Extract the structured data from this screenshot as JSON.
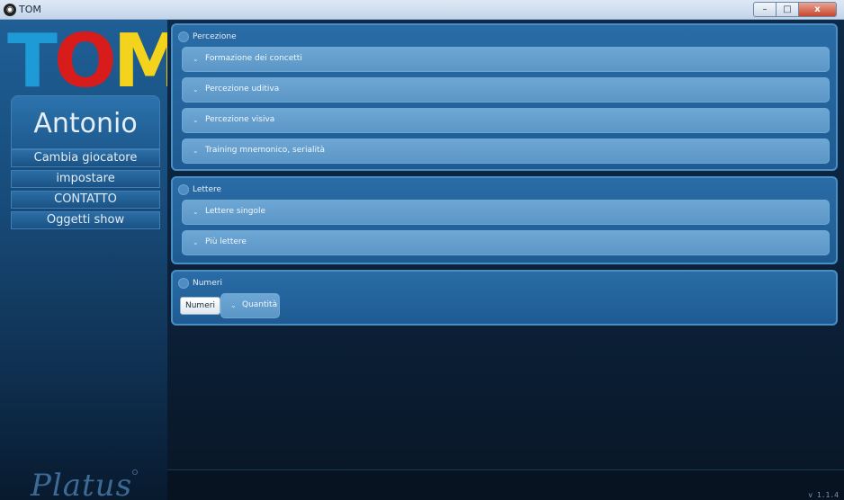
{
  "window": {
    "title": "TOM",
    "controls": [
      "–",
      "□",
      "x"
    ]
  },
  "sidebar": {
    "logo": {
      "t": "T",
      "o": "O",
      "m": "M"
    },
    "user_name": "Antonio",
    "buttons": [
      "Cambia giocatore",
      "impostare",
      "CONTATTO",
      "Oggetti show"
    ],
    "brand": "Platus"
  },
  "version": "v 1.1.4",
  "groups": [
    {
      "title": "Percezione",
      "items": [
        "Formazione dei concetti",
        "Percezione uditiva",
        "Percezione visiva",
        "Training mnemonico, serialità"
      ]
    },
    {
      "title": "Lettere",
      "items": [
        "Lettere singole",
        "Più lettere"
      ]
    },
    {
      "title": "Numeri",
      "chip": "Numeri",
      "items": [
        "Quantità"
      ]
    }
  ],
  "icons": {
    "chevron": "chevron-down-icon",
    "group": "circle-icon"
  },
  "colors": {
    "logo_t": "#1e9bd6",
    "logo_o": "#d81c1c",
    "logo_m": "#f4d31c",
    "panel": "#2a6ca6",
    "item": "#6ea7d4"
  }
}
